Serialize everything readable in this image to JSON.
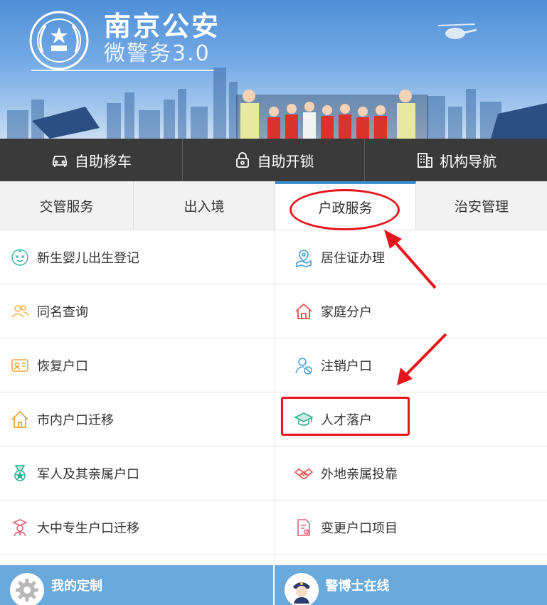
{
  "banner": {
    "title": "南京公安",
    "subtitle": "微警务3.0"
  },
  "quickbar": [
    {
      "label": "自助移车",
      "icon": "car-icon"
    },
    {
      "label": "自助开锁",
      "icon": "lock-icon"
    },
    {
      "label": "机构导航",
      "icon": "building-icon"
    }
  ],
  "tabs": [
    {
      "label": "交管服务",
      "active": false
    },
    {
      "label": "出入境",
      "active": false
    },
    {
      "label": "户政服务",
      "active": true
    },
    {
      "label": "治安管理",
      "active": false
    }
  ],
  "services": {
    "left": [
      {
        "label": "新生婴儿出生登记",
        "icon": "baby-icon",
        "color": "#3cc0a9"
      },
      {
        "label": "同名查询",
        "icon": "users-icon",
        "color": "#f0b44c"
      },
      {
        "label": "恢复户口",
        "icon": "id-card-icon",
        "color": "#f0a53a"
      },
      {
        "label": "市内户口迁移",
        "icon": "house-icon",
        "color": "#f0a53a"
      },
      {
        "label": "军人及其亲属户口",
        "icon": "medal-icon",
        "color": "#2bb08f"
      },
      {
        "label": "大中专生户口迁移",
        "icon": "graduate-icon",
        "color": "#e5637a"
      },
      {
        "label": "",
        "icon": "",
        "color": ""
      }
    ],
    "right": [
      {
        "label": "居住证办理",
        "icon": "location-icon",
        "color": "#4a9fd8"
      },
      {
        "label": "家庭分户",
        "icon": "home-icon",
        "color": "#e5544b"
      },
      {
        "label": "注销户口",
        "icon": "user-cancel-icon",
        "color": "#4a9fd8"
      },
      {
        "label": "人才落户",
        "icon": "graduation-cap-icon",
        "color": "#2bb08f"
      },
      {
        "label": "外地亲属投靠",
        "icon": "handshake-icon",
        "color": "#e5544b"
      },
      {
        "label": "变更户口项目",
        "icon": "document-edit-icon",
        "color": "#e5637a"
      },
      {
        "label": "",
        "icon": "",
        "color": ""
      }
    ]
  },
  "bottombar": [
    {
      "label": "我的定制",
      "icon": "gear-icon"
    },
    {
      "label": "警博士在线",
      "icon": "police-avatar-icon"
    }
  ],
  "colors": {
    "accent": "#3b8fd5",
    "annotation": "#e8141c",
    "bar": "#3a3a3a",
    "bottom": "#69a9dc"
  }
}
